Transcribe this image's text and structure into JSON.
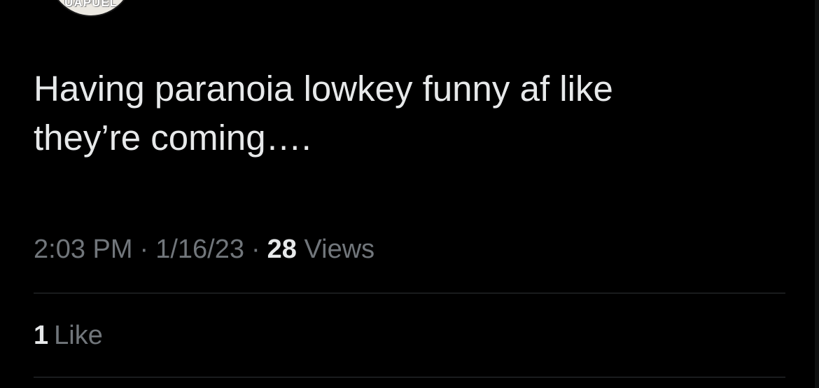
{
  "tweet": {
    "avatar_logo_text": "UAPUEL",
    "text": "Having paranoia lowkey funny af like\nthey’re coming….",
    "time": "2:03 PM",
    "separator": "·",
    "date": "1/16/23",
    "views_count": "28",
    "views_label": "Views",
    "likes_count": "1",
    "likes_label": "Like"
  },
  "colors": {
    "background": "#000000",
    "primary_text": "#e7e9ea",
    "secondary_text": "#71767b",
    "divider": "#2f3336"
  }
}
